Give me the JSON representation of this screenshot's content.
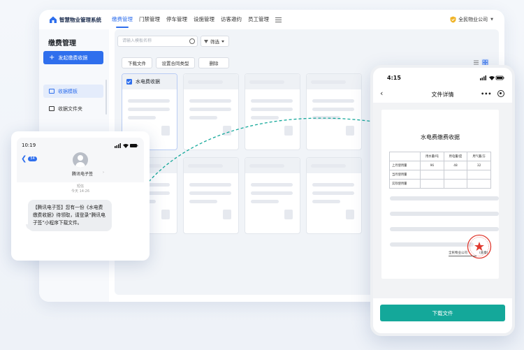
{
  "app": {
    "logo_text": "智慧物业管理系统",
    "nav": [
      "缴费管理",
      "门禁管理",
      "停车管理",
      "设施管理",
      "访客邀约",
      "员工管理"
    ],
    "company": "全民物业公司"
  },
  "sidebar": {
    "title": "缴费管理",
    "new_button": "发起缴费收据",
    "items": [
      {
        "label": "收据模板"
      },
      {
        "label": "收据文件夹"
      }
    ]
  },
  "toolbar": {
    "search_placeholder": "请输入模板名称",
    "filter_label": "筛选",
    "download_label": "下载文件",
    "contract_type_label": "设置合同类型",
    "delete_label": "删除"
  },
  "cards": {
    "first_title": "水电费收据"
  },
  "sms": {
    "time": "10:19",
    "unread_badge": "54",
    "sender": "腾讯电子签",
    "meta_line1": "短信",
    "meta_line2": "今天 14:26",
    "message": "【腾讯电子签】您有一份《水电费缴费收据》待领取，请登录“腾讯电子签”小程序下载文件。"
  },
  "phone": {
    "time": "4:15",
    "title": "文件详情",
    "doc_title": "水电费缴费收据",
    "table": {
      "headers": [
        "",
        "用水量/吨",
        "用电量/度",
        "用气量/方"
      ],
      "rows": [
        [
          "上月使用量",
          "96",
          "48",
          "32"
        ],
        [
          "当月使用量",
          "",
          "",
          ""
        ],
        [
          "实际使用量",
          "",
          "",
          ""
        ]
      ]
    },
    "signature_company": "全民物业公司",
    "signature_suffix": "(盖章)",
    "download_button": "下载文件"
  },
  "colors": {
    "primary": "#2f6fed",
    "download_button": "#14a89a",
    "seal": "#e0392f",
    "connector": "#14a89a"
  }
}
